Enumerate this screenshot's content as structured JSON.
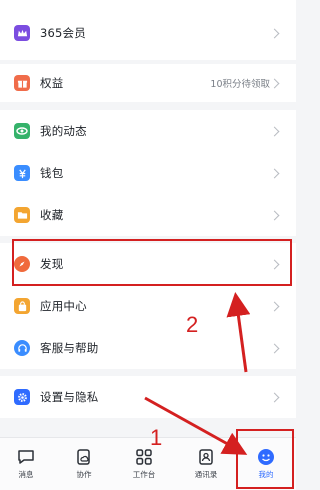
{
  "menu": {
    "vip": {
      "label": "365会员",
      "icon": "crown-icon",
      "color": "#7b4de0"
    },
    "benefits": {
      "label": "权益",
      "value": "10积分待领取",
      "icon": "gift-icon",
      "color": "#f06c4a"
    },
    "moments": {
      "label": "我的动态",
      "icon": "eye-icon",
      "color": "#35b26a"
    },
    "wallet": {
      "label": "钱包",
      "icon": "wallet-icon",
      "color": "#3a8dff"
    },
    "favorites": {
      "label": "收藏",
      "icon": "folder-icon",
      "color": "#f3a531"
    },
    "discover": {
      "label": "发现",
      "icon": "compass-icon",
      "color": "#f06a3c"
    },
    "apps": {
      "label": "应用中心",
      "icon": "bag-icon",
      "color": "#f3a531"
    },
    "support": {
      "label": "客服与帮助",
      "icon": "headset-icon",
      "color": "#3a8dff"
    },
    "settings": {
      "label": "设置与隐私",
      "icon": "gear-icon",
      "color": "#2f6bff"
    }
  },
  "tabbar": {
    "messages": "消息",
    "collab": "协作",
    "workbench": "工作台",
    "contacts": "通讯录",
    "me": "我的"
  },
  "annotations": {
    "step1": "1",
    "step2": "2",
    "color": "#d42020"
  }
}
